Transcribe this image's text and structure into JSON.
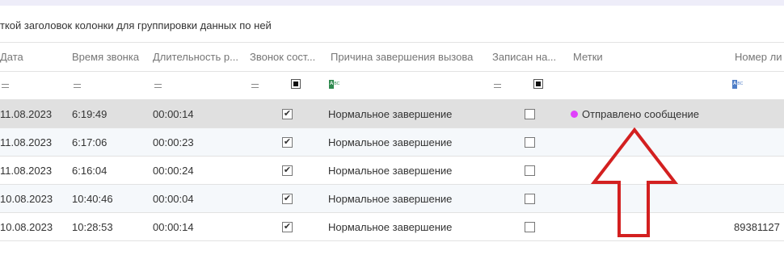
{
  "group_panel": {
    "hint": "ткой заголовок колонки для группировки данных по ней"
  },
  "columns": [
    "Дата",
    "Время звонка",
    "Длительность р...",
    "Звонок сост...",
    "Причина завершения вызова",
    "Записан на...",
    "Метки",
    "Номер ли"
  ],
  "rows": [
    {
      "date": "11.08.2023",
      "time": "6:19:49",
      "duration": "00:00:14",
      "connected": true,
      "reason": "Нормальное завершение",
      "recorded": false,
      "tag": "Отправлено сообщение",
      "tag_color": "#e040fb",
      "number": ""
    },
    {
      "date": "11.08.2023",
      "time": "6:17:06",
      "duration": "00:00:23",
      "connected": true,
      "reason": "Нормальное завершение",
      "recorded": false,
      "tag": "",
      "number": ""
    },
    {
      "date": "11.08.2023",
      "time": "6:16:04",
      "duration": "00:00:24",
      "connected": true,
      "reason": "Нормальное завершение",
      "recorded": false,
      "tag": "",
      "number": ""
    },
    {
      "date": "10.08.2023",
      "time": "10:40:46",
      "duration": "00:00:04",
      "connected": true,
      "reason": "Нормальное завершение",
      "recorded": false,
      "tag": "",
      "number": ""
    },
    {
      "date": "10.08.2023",
      "time": "10:28:53",
      "duration": "00:00:14",
      "connected": true,
      "reason": "Нормальное завершение",
      "recorded": false,
      "tag": "",
      "number": "89381127"
    }
  ],
  "checkmark": "✔",
  "colors": {
    "arrow": "#d32020",
    "selected_row": "#e0e0e0",
    "alt_row": "#f5f8fb"
  }
}
